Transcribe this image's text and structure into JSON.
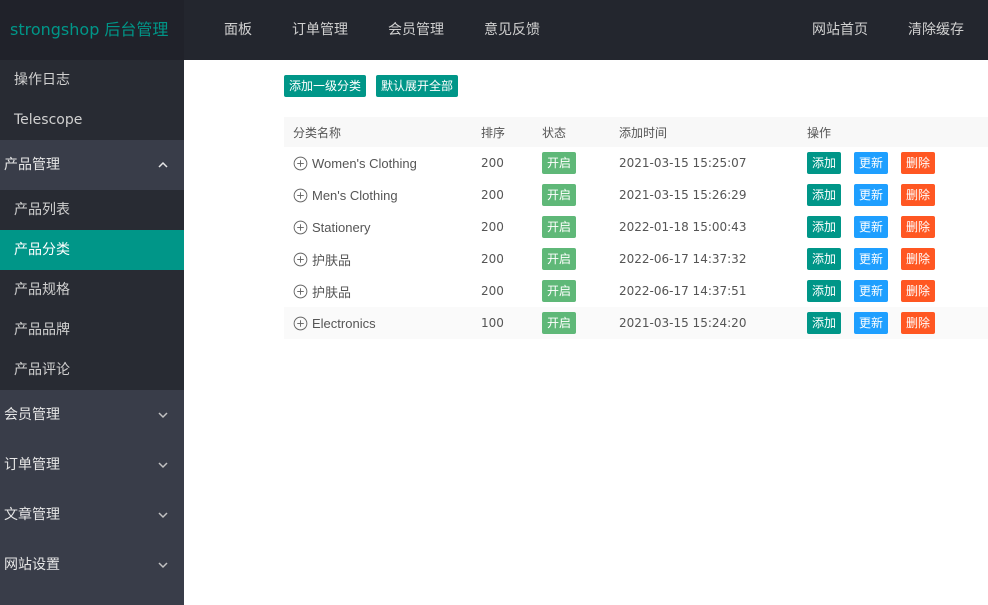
{
  "header": {
    "logo": "strongshop 后台管理",
    "nav": [
      "面板",
      "订单管理",
      "会员管理",
      "意见反馈"
    ],
    "nav_right": [
      "网站首页",
      "清除缓存"
    ]
  },
  "sidebar": {
    "top_items": [
      "操作日志",
      "Telescope"
    ],
    "groups": [
      {
        "label": "产品管理",
        "expanded": true,
        "children": [
          "产品列表",
          "产品分类",
          "产品规格",
          "产品品牌",
          "产品评论"
        ],
        "active": "产品分类"
      },
      {
        "label": "会员管理",
        "expanded": false
      },
      {
        "label": "订单管理",
        "expanded": false
      },
      {
        "label": "文章管理",
        "expanded": false
      },
      {
        "label": "网站设置",
        "expanded": false
      }
    ]
  },
  "toolbar": {
    "add_top": "添加一级分类",
    "expand_all": "默认展开全部"
  },
  "table": {
    "columns": [
      "分类名称",
      "排序",
      "状态",
      "添加时间",
      "操作"
    ],
    "actions": [
      "添加",
      "更新",
      "删除"
    ],
    "rows": [
      {
        "name": "Women's Clothing",
        "sort": "200",
        "status": "开启",
        "created": "2021-03-15 15:25:07"
      },
      {
        "name": "Men's Clothing",
        "sort": "200",
        "status": "开启",
        "created": "2021-03-15 15:26:29"
      },
      {
        "name": "Stationery",
        "sort": "200",
        "status": "开启",
        "created": "2022-01-18 15:00:43"
      },
      {
        "name": "护肤品",
        "sort": "200",
        "status": "开启",
        "created": "2022-06-17 14:37:32"
      },
      {
        "name": "护肤品",
        "sort": "200",
        "status": "开启",
        "created": "2022-06-17 14:37:51"
      },
      {
        "name": "Electronics",
        "sort": "100",
        "status": "开启",
        "created": "2021-03-15 15:24:20"
      }
    ]
  },
  "colors": {
    "teal": "#009688",
    "blue": "#1e9fff",
    "red": "#ff5722",
    "green": "#5fb878",
    "header_bg": "#23262e",
    "sidebar_bg": "#393d49"
  }
}
